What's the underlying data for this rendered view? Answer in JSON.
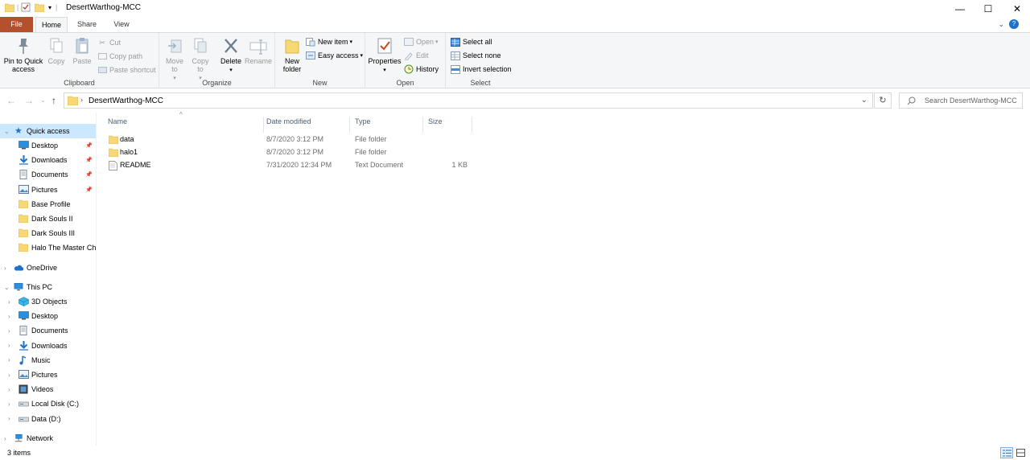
{
  "window": {
    "title": "DesertWarthog-MCC",
    "controls": {
      "minimize": "—",
      "maximize": "☐",
      "close": "✕"
    }
  },
  "ribbon_tabs": [
    {
      "label": "File"
    },
    {
      "label": "Home"
    },
    {
      "label": "Share"
    },
    {
      "label": "View"
    }
  ],
  "ribbon": {
    "clipboard": {
      "label": "Clipboard",
      "pin": "Pin to Quick access",
      "copy": "Copy",
      "paste": "Paste",
      "cut": "Cut",
      "copy_path": "Copy path",
      "paste_shortcut": "Paste shortcut"
    },
    "organize": {
      "label": "Organize",
      "move_to": "Move to",
      "copy_to": "Copy to",
      "delete": "Delete",
      "rename": "Rename"
    },
    "new": {
      "label": "New",
      "new_folder": "New folder",
      "new_item": "New item",
      "easy_access": "Easy access"
    },
    "open": {
      "label": "Open",
      "properties": "Properties",
      "open": "Open",
      "edit": "Edit",
      "history": "History"
    },
    "select": {
      "label": "Select",
      "select_all": "Select all",
      "select_none": "Select none",
      "invert_selection": "Invert selection"
    }
  },
  "address": {
    "crumb": "DesertWarthog-MCC",
    "search_placeholder": "Search DesertWarthog-MCC"
  },
  "nav": {
    "quick_access": "Quick access",
    "quick_items": [
      {
        "label": "Desktop",
        "icon": "desktop-icon"
      },
      {
        "label": "Downloads",
        "icon": "downloads-icon"
      },
      {
        "label": "Documents",
        "icon": "documents-icon"
      },
      {
        "label": "Pictures",
        "icon": "pictures-icon"
      },
      {
        "label": "Base Profile",
        "icon": "folder-icon"
      },
      {
        "label": "Dark Souls II",
        "icon": "folder-icon"
      },
      {
        "label": "Dark Souls III",
        "icon": "folder-icon"
      },
      {
        "label": "Halo  The Master Ch",
        "icon": "folder-icon"
      }
    ],
    "onedrive": "OneDrive",
    "this_pc": "This PC",
    "pc_items": [
      {
        "label": "3D Objects",
        "icon": "3d-objects-icon"
      },
      {
        "label": "Desktop",
        "icon": "desktop-icon"
      },
      {
        "label": "Documents",
        "icon": "documents-icon"
      },
      {
        "label": "Downloads",
        "icon": "downloads-icon"
      },
      {
        "label": "Music",
        "icon": "music-icon"
      },
      {
        "label": "Pictures",
        "icon": "pictures-icon"
      },
      {
        "label": "Videos",
        "icon": "videos-icon"
      },
      {
        "label": "Local Disk (C:)",
        "icon": "drive-icon"
      },
      {
        "label": "Data (D:)",
        "icon": "drive-icon"
      }
    ],
    "network": "Network"
  },
  "columns": {
    "name": "Name",
    "date": "Date modified",
    "type": "Type",
    "size": "Size"
  },
  "files": [
    {
      "name": "data",
      "date": "8/7/2020 3:12 PM",
      "type": "File folder",
      "size": "",
      "icon": "folder-icon"
    },
    {
      "name": "halo1",
      "date": "8/7/2020 3:12 PM",
      "type": "File folder",
      "size": "",
      "icon": "folder-icon"
    },
    {
      "name": "README",
      "date": "7/31/2020 12:34 PM",
      "type": "Text Document",
      "size": "1 KB",
      "icon": "text-file-icon"
    }
  ],
  "status": {
    "item_count": "3 items"
  },
  "colors": {
    "file_tab": "#b5502f",
    "selection": "#cce8ff",
    "folder": "#f8d775",
    "accent_blue": "#1e72c9"
  }
}
